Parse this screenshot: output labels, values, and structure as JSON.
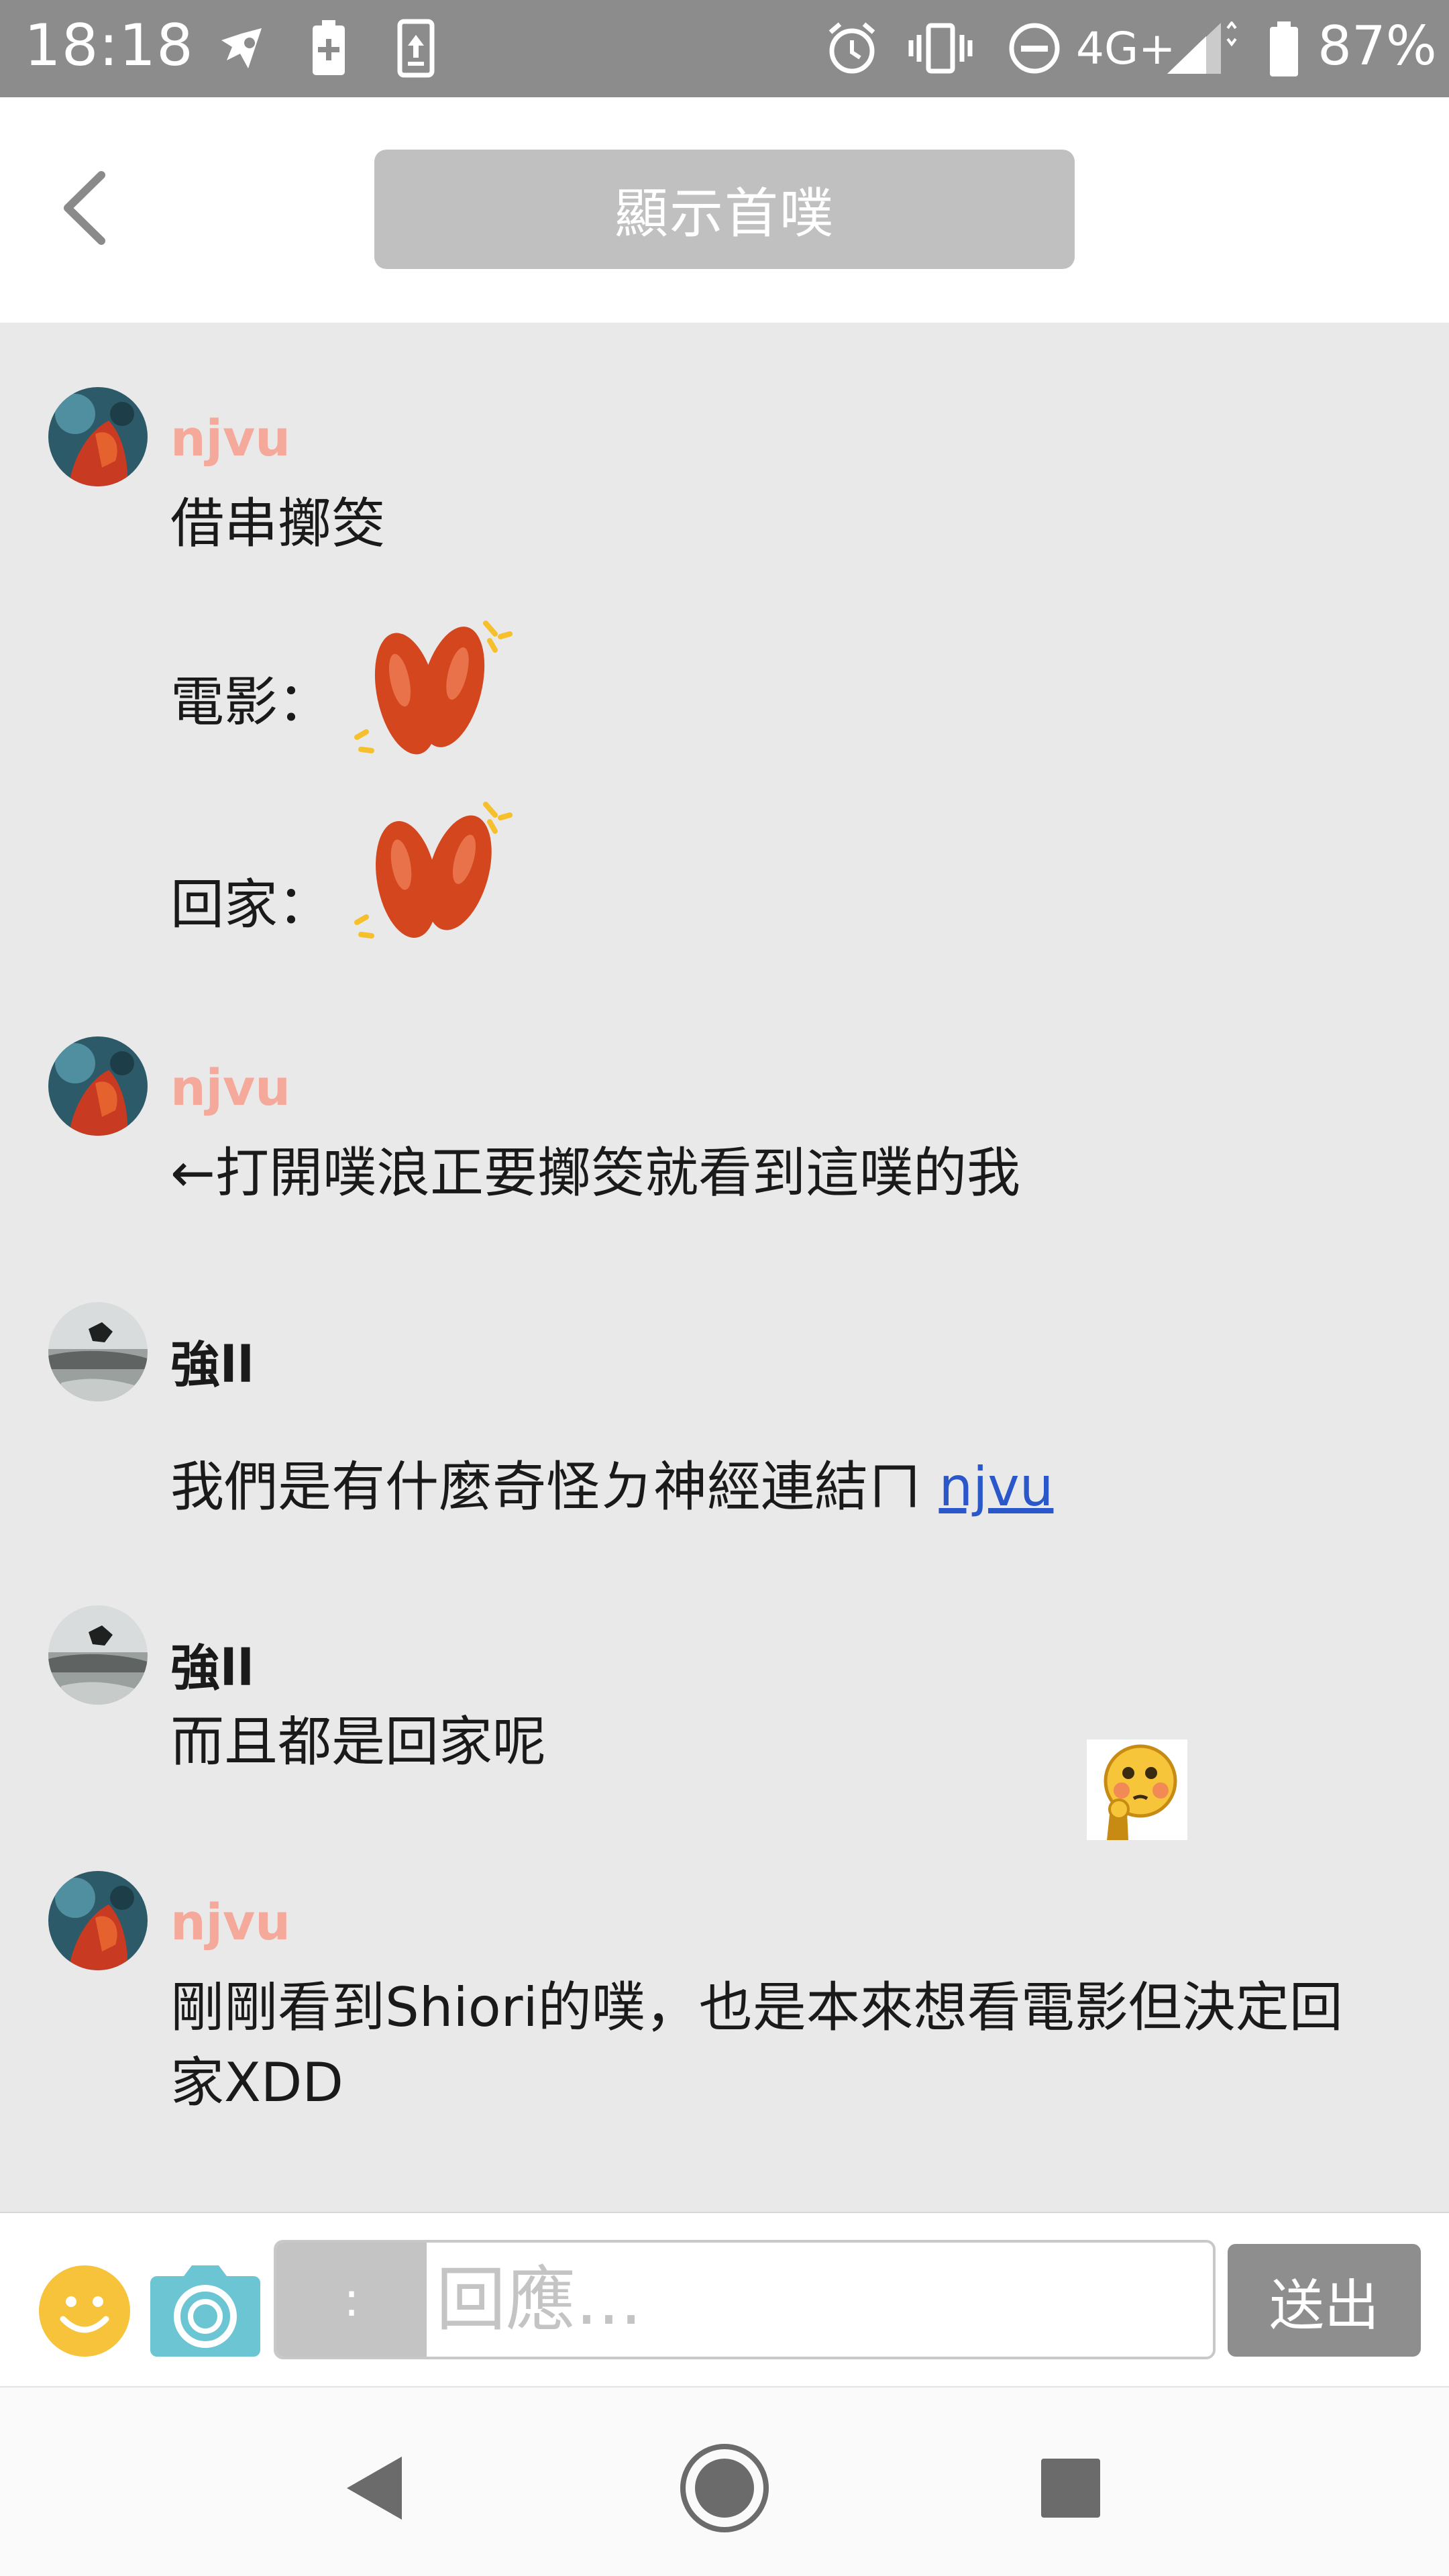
{
  "status_bar": {
    "time": "18:18",
    "network": "4G+",
    "battery": "87%",
    "icons": [
      "notification-icon",
      "battery-charge-icon",
      "upload-icon",
      "alarm-icon",
      "vibrate-icon",
      "do-not-disturb-icon",
      "signal-icon",
      "battery-icon"
    ]
  },
  "header": {
    "back_icon": "chevron-left-icon",
    "first_plurk_label": "顯示首噗"
  },
  "messages": [
    {
      "user": "njvu",
      "lines": [
        "借串擲筊",
        "電影：",
        "回家："
      ]
    },
    {
      "user": "njvu",
      "text": "←打開噗浪正要擲筊就看到這噗的我"
    },
    {
      "user": "強ll",
      "text": "我們是有什麼奇怪ㄉ神經連結ㄇ",
      "mention": "njvu"
    },
    {
      "user": "強ll",
      "text": "而且都是回家呢"
    },
    {
      "user": "njvu",
      "text_line1": "剛剛看到Shiori的噗，也是本來想看電影但決定回",
      "text_line2": "家XDD"
    }
  ],
  "input_bar": {
    "qualifier": ":",
    "reply_placeholder": "回應...",
    "send_label": "送出"
  },
  "colors": {
    "status_bar": "#8c8c8c",
    "content_bg": "#e9e9e9",
    "username_pink": "#f4a99b",
    "link_blue": "#2a57c9",
    "button_gray": "#c0c0c0",
    "send_gray": "#8e8e8e",
    "emoji_yellow": "#f6c33a",
    "camera_teal": "#6cc5d3",
    "jiaobei_red": "#d4461e"
  }
}
